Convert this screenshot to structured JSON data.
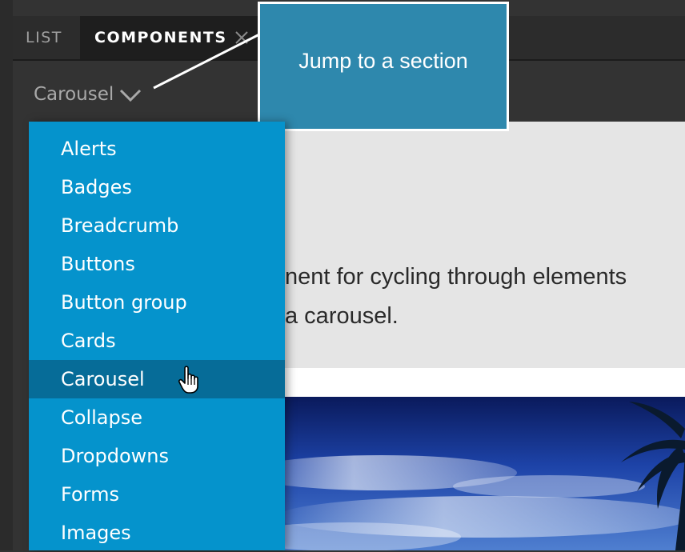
{
  "tabs": [
    {
      "label": "LIST"
    },
    {
      "label": "COMPONENTS"
    }
  ],
  "section_select": {
    "label": "Carousel"
  },
  "callout": {
    "text": "Jump to a section"
  },
  "content": {
    "lead_line_1": "nent for cycling through elements",
    "lead_line_2": "a carousel."
  },
  "menu": {
    "items": [
      "Alerts",
      "Badges",
      "Breadcrumb",
      "Buttons",
      "Button group",
      "Cards",
      "Carousel",
      "Collapse",
      "Dropdowns",
      "Forms",
      "Images"
    ],
    "active": "Carousel"
  },
  "icons": {
    "tab_close": "close-icon",
    "select_chevron": "chevron-down-icon",
    "cursor": "hand-pointer-icon"
  },
  "colors": {
    "menu_bg": "#0593cc",
    "menu_active": "#066c98",
    "callout_bg": "#2e88ad",
    "app_bg": "#333333"
  }
}
